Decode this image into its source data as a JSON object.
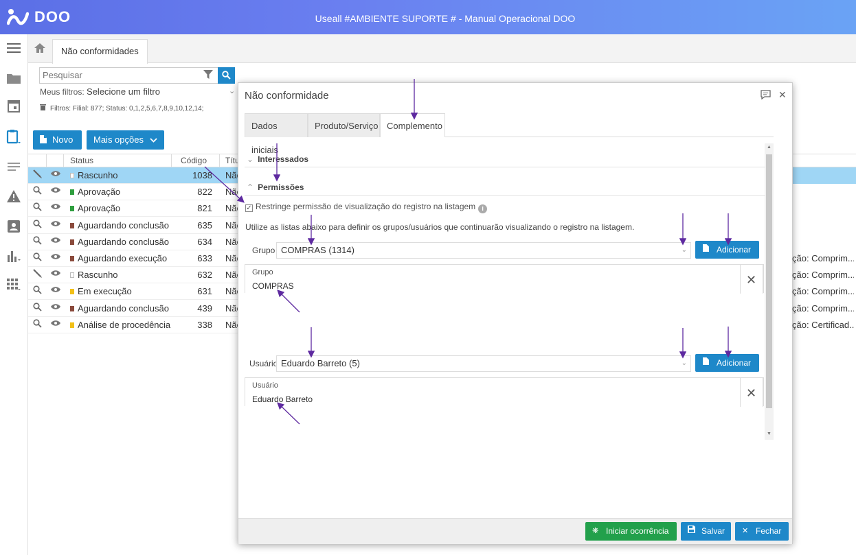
{
  "app": {
    "logo_text": "DOO",
    "title": "Useall #AMBIENTE SUPORTE # - Manual Operacional DOO"
  },
  "tabs": {
    "active_label": "Não conformidades"
  },
  "search": {
    "placeholder": "Pesquisar"
  },
  "filters": {
    "my_filters_label": "Meus filtros:",
    "my_filters_value": "Selecione um filtro",
    "summary": "Filtros: Filial: 877; Status: 0,1,2,5,6,7,8,9,10,12,14;"
  },
  "toolbar": {
    "new_label": "Novo",
    "more_label": "Mais opções"
  },
  "grid": {
    "headers": {
      "status": "Status",
      "code": "Código",
      "title": "Títu"
    },
    "rows": [
      {
        "action": "edit",
        "status": "Rascunho",
        "color": "#ffffff",
        "code": "1038",
        "title": "Não",
        "right": ""
      },
      {
        "action": "view",
        "status": "Aprovação",
        "color": "#2e9e3e",
        "code": "822",
        "title": "Não",
        "right": ""
      },
      {
        "action": "view",
        "status": "Aprovação",
        "color": "#2e9e3e",
        "code": "821",
        "title": "Não",
        "right": ""
      },
      {
        "action": "view",
        "status": "Aguardando conclusão",
        "color": "#8a4a3c",
        "code": "635",
        "title": "Não",
        "right": ""
      },
      {
        "action": "view",
        "status": "Aguardando conclusão",
        "color": "#8a4a3c",
        "code": "634",
        "title": "Não",
        "right": ""
      },
      {
        "action": "view",
        "status": "Aguardando execução",
        "color": "#8a4a3c",
        "code": "633",
        "title": "Não",
        "right": "ção: Comprim..."
      },
      {
        "action": "edit",
        "status": "Rascunho",
        "color": "#ffffff",
        "code": "632",
        "title": "Não",
        "right": "ção: Comprim..."
      },
      {
        "action": "view",
        "status": "Em execução",
        "color": "#f2c018",
        "code": "631",
        "title": "Não",
        "right": "ção: Comprim..."
      },
      {
        "action": "view",
        "status": "Aguardando conclusão",
        "color": "#8a4a3c",
        "code": "439",
        "title": "Não",
        "right": "ção: Comprim..."
      },
      {
        "action": "view",
        "status": "Análise de procedência",
        "color": "#f2c018",
        "code": "338",
        "title": "Não",
        "right": "ção: Certificad..."
      }
    ]
  },
  "modal": {
    "title": "Não conformidade",
    "tabs": [
      "Dados iniciais",
      "Produto/Serviço",
      "Complemento"
    ],
    "section_interessados": "Interessados",
    "section_permissoes": "Permissões",
    "restrict_label": "Restringe permissão de visualização do registro na listagem",
    "hint": "Utilize as listas abaixo para definir os grupos/usuários que continuarão visualizando o registro na listagem.",
    "grupo_label": "Grupo",
    "grupo_value": "COMPRAS (1314)",
    "grupo_list_header": "Grupo",
    "grupo_list_item": "COMPRAS",
    "usuario_label": "Usuário",
    "usuario_value": "Eduardo Barreto  (5)",
    "usuario_list_header": "Usuário",
    "usuario_list_item": "Eduardo Barreto",
    "add_label": "Adicionar",
    "footer": {
      "start_label": "Iniciar ocorrência",
      "save_label": "Salvar",
      "close_label": "Fechar"
    }
  },
  "colors": {
    "accent": "#1e88c9",
    "success": "#22a04b",
    "selected_row": "#9fd6f5",
    "annotation_arrow": "#5e2aa0"
  }
}
